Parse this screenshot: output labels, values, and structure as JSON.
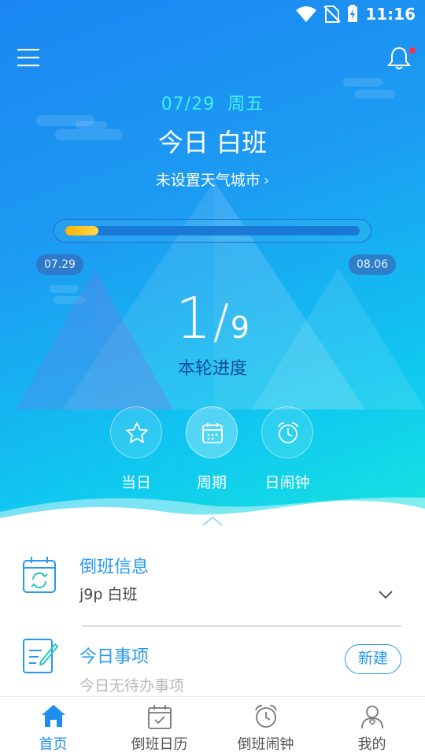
{
  "status_bar": {
    "time": "11:16"
  },
  "header": {
    "date": "07/29",
    "weekday": "周五",
    "shift_title": "今日 白班",
    "weather_link": "未设置天气城市",
    "weather_chevron": "›"
  },
  "cycle": {
    "start_date": "07.29",
    "end_date": "08.06",
    "current": "1",
    "separator": "/",
    "total": "9",
    "label": "本轮进度",
    "progress_fraction": 0.111
  },
  "quick_actions": [
    {
      "label": "当日",
      "icon": "star-icon"
    },
    {
      "label": "周期",
      "icon": "calendar-icon"
    },
    {
      "label": "日闹钟",
      "icon": "alarm-clock-icon"
    }
  ],
  "shift_info": {
    "title": "倒班信息",
    "subtitle": "j9p 白班"
  },
  "today_items": {
    "title": "今日事项",
    "subtitle": "今日无待办事项",
    "new_button": "新建"
  },
  "tabbar": {
    "items": [
      {
        "label": "首页",
        "icon": "home-icon",
        "active": true
      },
      {
        "label": "倒班日历",
        "icon": "calendar-check-icon",
        "active": false
      },
      {
        "label": "倒班闹钟",
        "icon": "alarm-clock-icon",
        "active": false
      },
      {
        "label": "我的",
        "icon": "user-icon",
        "active": false
      }
    ]
  },
  "colors": {
    "accent": "#2799EE",
    "date_cyan": "#3FF2F0",
    "progress_fill": "#FFC107",
    "notification_dot": "#FF2D4A"
  }
}
